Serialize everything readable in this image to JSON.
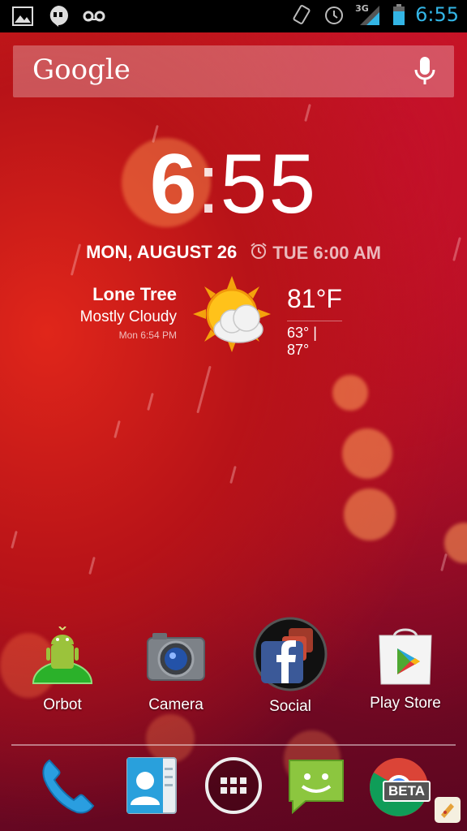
{
  "status_bar": {
    "time": "6:55",
    "network": "3G",
    "left_icons": [
      "image-icon",
      "hangouts-icon",
      "voicemail-icon"
    ],
    "right_icons": [
      "vibrate-icon",
      "alarm-icon",
      "signal-icon",
      "battery-icon"
    ]
  },
  "search": {
    "logo": "Google",
    "mic_icon": "mic-icon"
  },
  "clock": {
    "hour": "6",
    "colon": ":",
    "minutes": "55"
  },
  "date": {
    "text": "MON, AUGUST 26",
    "alarm": "TUE 6:00 AM"
  },
  "weather": {
    "city": "Lone Tree",
    "condition": "Mostly Cloudy",
    "updated": "Mon 6:54 PM",
    "temperature": "81°F",
    "range": "63° | 87°",
    "icon": "partly-cloudy-icon"
  },
  "apps": [
    {
      "label": "Orbot",
      "icon": "orbot-icon"
    },
    {
      "label": "Camera",
      "icon": "camera-icon"
    },
    {
      "label": "Social",
      "icon": "social-folder-icon"
    },
    {
      "label": "Play Store",
      "icon": "play-store-icon"
    }
  ],
  "dock": [
    {
      "icon": "phone-icon"
    },
    {
      "icon": "contacts-icon"
    },
    {
      "icon": "app-drawer-icon"
    },
    {
      "icon": "messaging-icon"
    },
    {
      "icon": "chrome-beta-icon",
      "badge": "BETA"
    }
  ],
  "colors": {
    "status_time": "#33b5e5",
    "background": "#b81318"
  }
}
